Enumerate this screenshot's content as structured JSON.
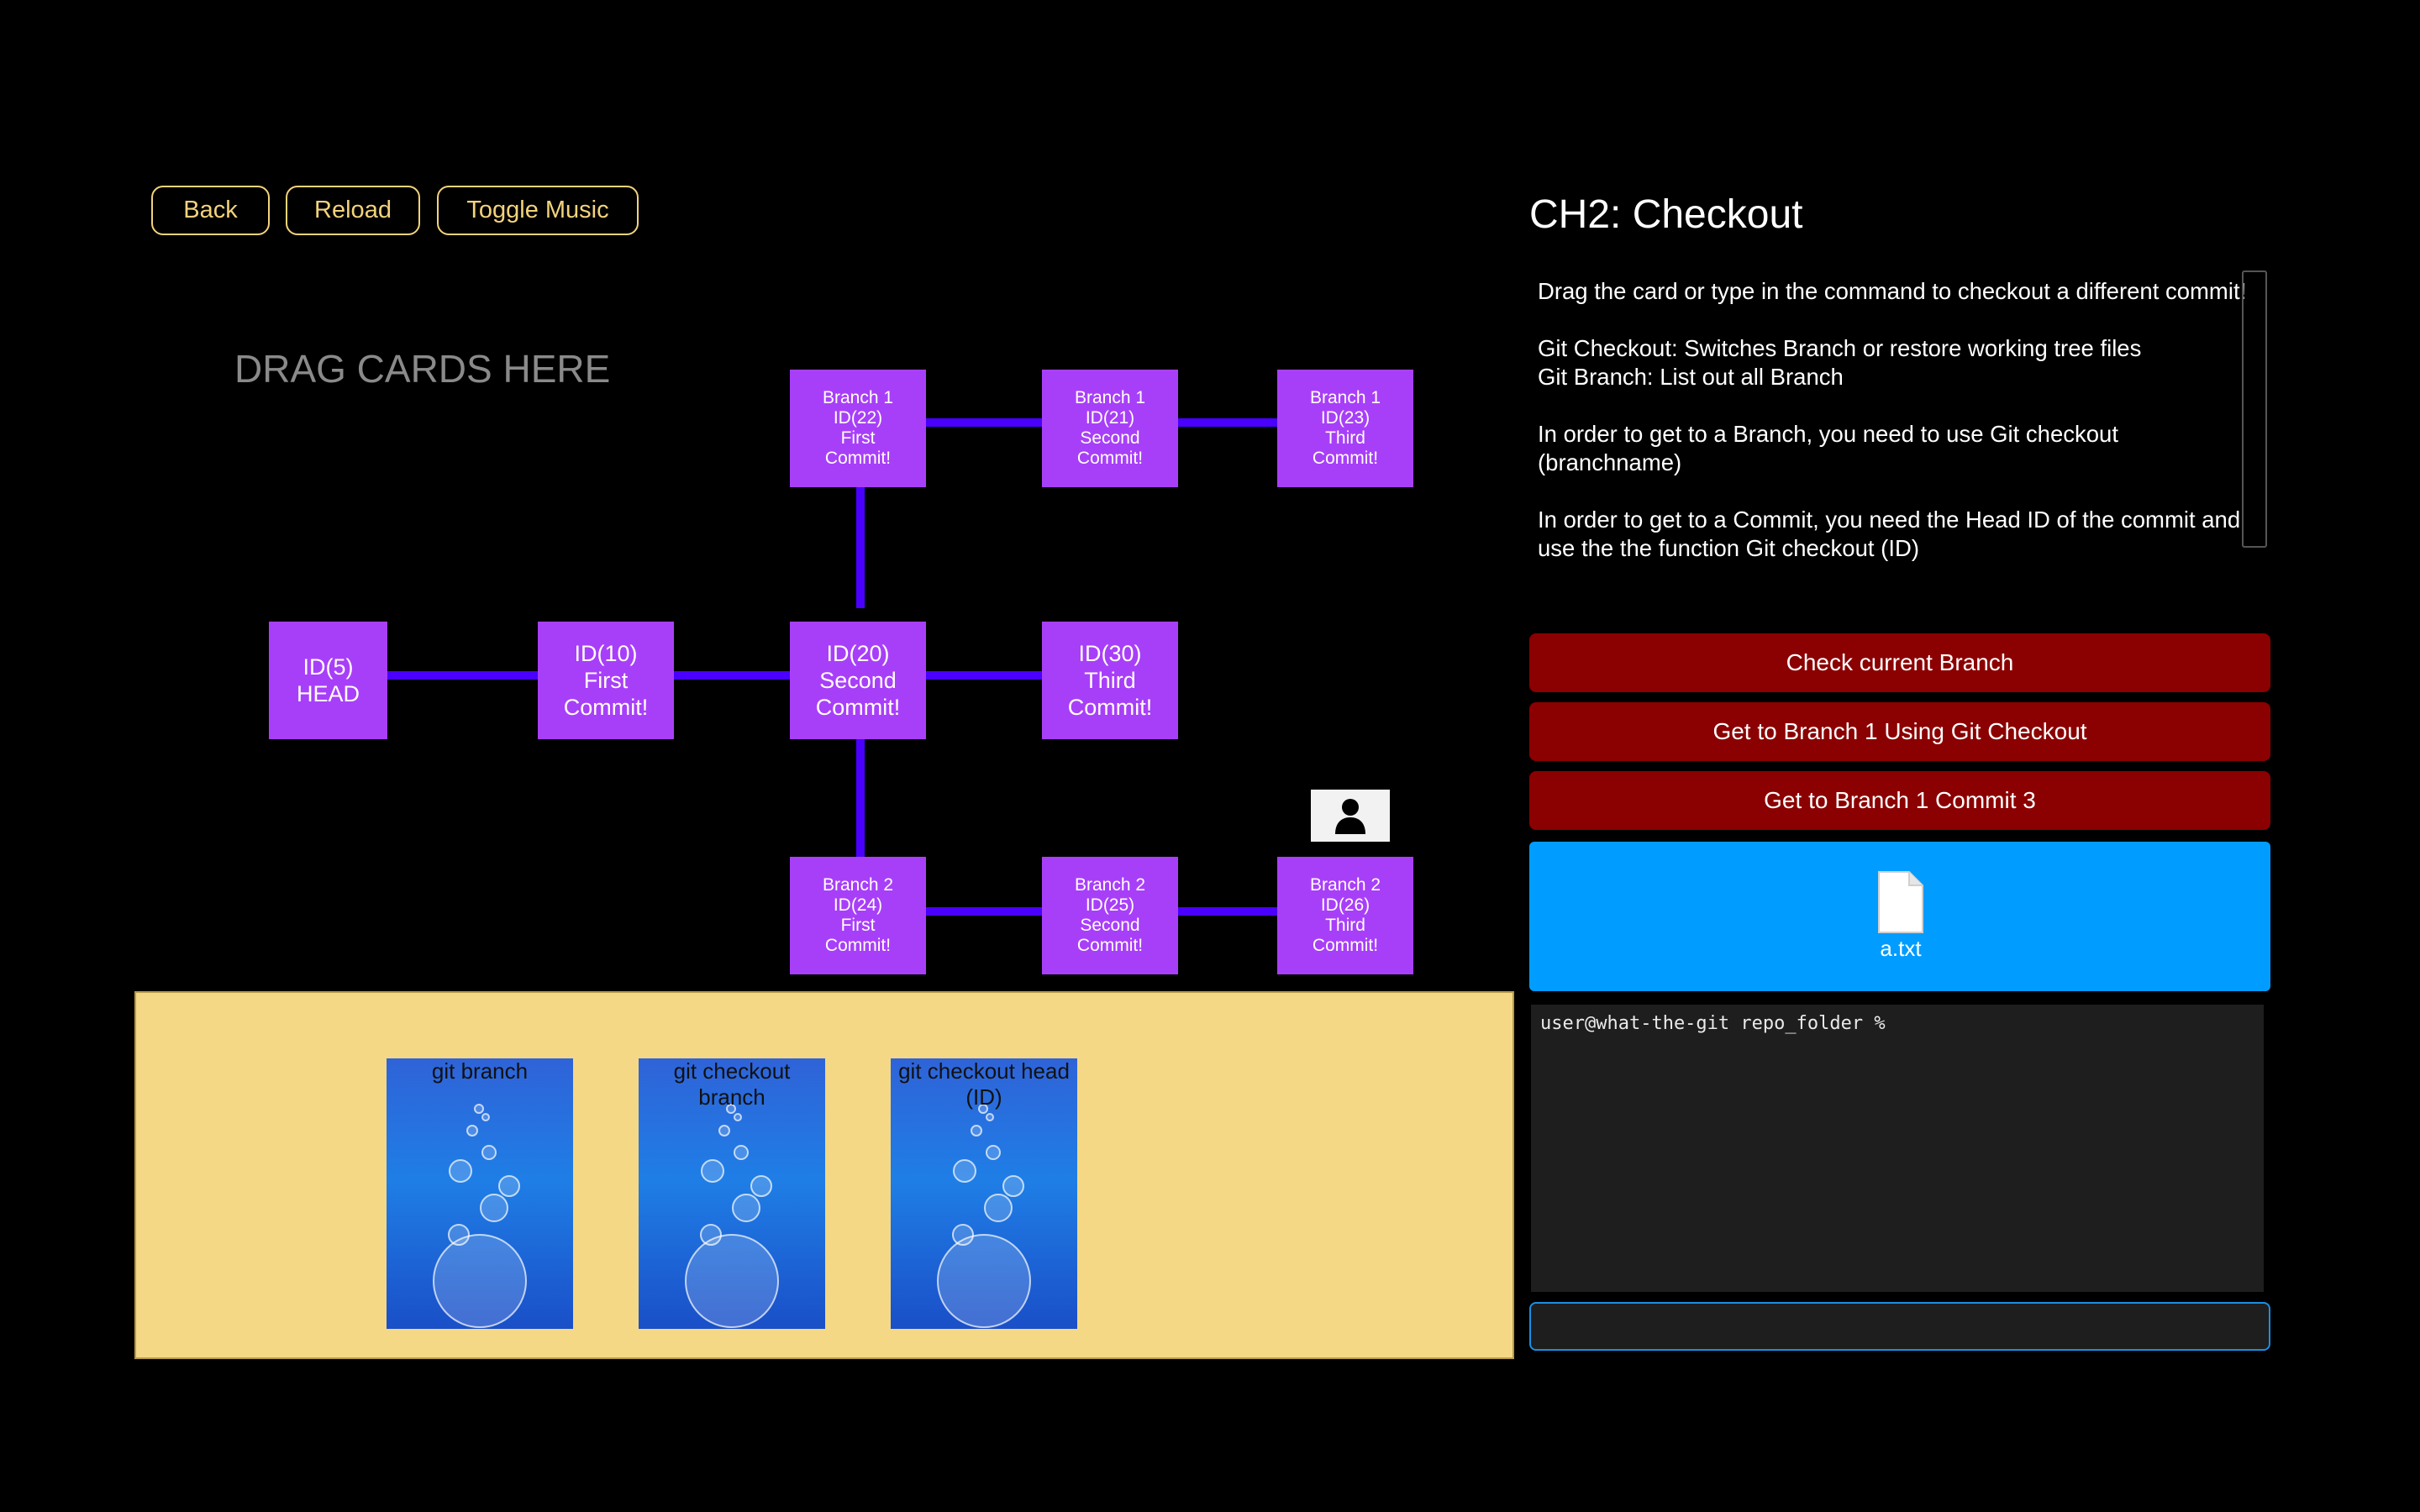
{
  "toolbar": {
    "back_label": "Back",
    "reload_label": "Reload",
    "music_label": "Toggle Music"
  },
  "drop_zone": {
    "title": "DRAG CARDS HERE"
  },
  "graph": {
    "line_color": "#4a00ff",
    "node_color": "#a83ff8",
    "main": [
      {
        "lines": [
          "ID(5)",
          "HEAD"
        ]
      },
      {
        "lines": [
          "ID(10)",
          "First",
          "Commit!"
        ]
      },
      {
        "lines": [
          "ID(20)",
          "Second",
          "Commit!"
        ]
      },
      {
        "lines": [
          "ID(30)",
          "Third",
          "Commit!"
        ]
      }
    ],
    "branch1": [
      {
        "lines": [
          "Branch 1",
          "ID(22)",
          "First",
          "Commit!"
        ]
      },
      {
        "lines": [
          "Branch 1",
          "ID(21)",
          "Second",
          "Commit!"
        ]
      },
      {
        "lines": [
          "Branch 1",
          "ID(23)",
          "Third",
          "Commit!"
        ]
      }
    ],
    "branch2": [
      {
        "lines": [
          "Branch 2",
          "ID(24)",
          "First",
          "Commit!"
        ]
      },
      {
        "lines": [
          "Branch 2",
          "ID(25)",
          "Second",
          "Commit!"
        ]
      },
      {
        "lines": [
          "Branch 2",
          "ID(26)",
          "Third",
          "Commit!"
        ]
      }
    ],
    "current_position_icon": "user-icon"
  },
  "cards": [
    {
      "label": "git branch"
    },
    {
      "label": "git checkout branch"
    },
    {
      "label": "git checkout head (ID)"
    }
  ],
  "panel": {
    "title": "CH2: Checkout",
    "instructions": [
      "Drag the card or type in the command to checkout a different commit!",
      "Git Checkout: Switches Branch or restore working tree files",
      "Git Branch: List out all Branch",
      "In order to get to a Branch, you need to use Git checkout (branchname)",
      "In order to get to a Commit, you need the Head ID of the commit and use the the function Git checkout (ID)"
    ],
    "buttons": {
      "check_branch": "Check current Branch",
      "branch1_checkout": "Get to Branch 1 Using Git Checkout",
      "branch1_commit3": "Get to Branch 1 Commit 3"
    },
    "files": [
      {
        "name": "a.txt",
        "icon": "file-icon"
      }
    ],
    "terminal": {
      "prompt": "user@what-the-git repo_folder %"
    },
    "command_input": {
      "value": "",
      "placeholder": ""
    }
  },
  "colors": {
    "accent_outline": "#f2d37c",
    "action_button": "#8b0000",
    "file_area": "#009cff",
    "tray": "#f4d886"
  }
}
